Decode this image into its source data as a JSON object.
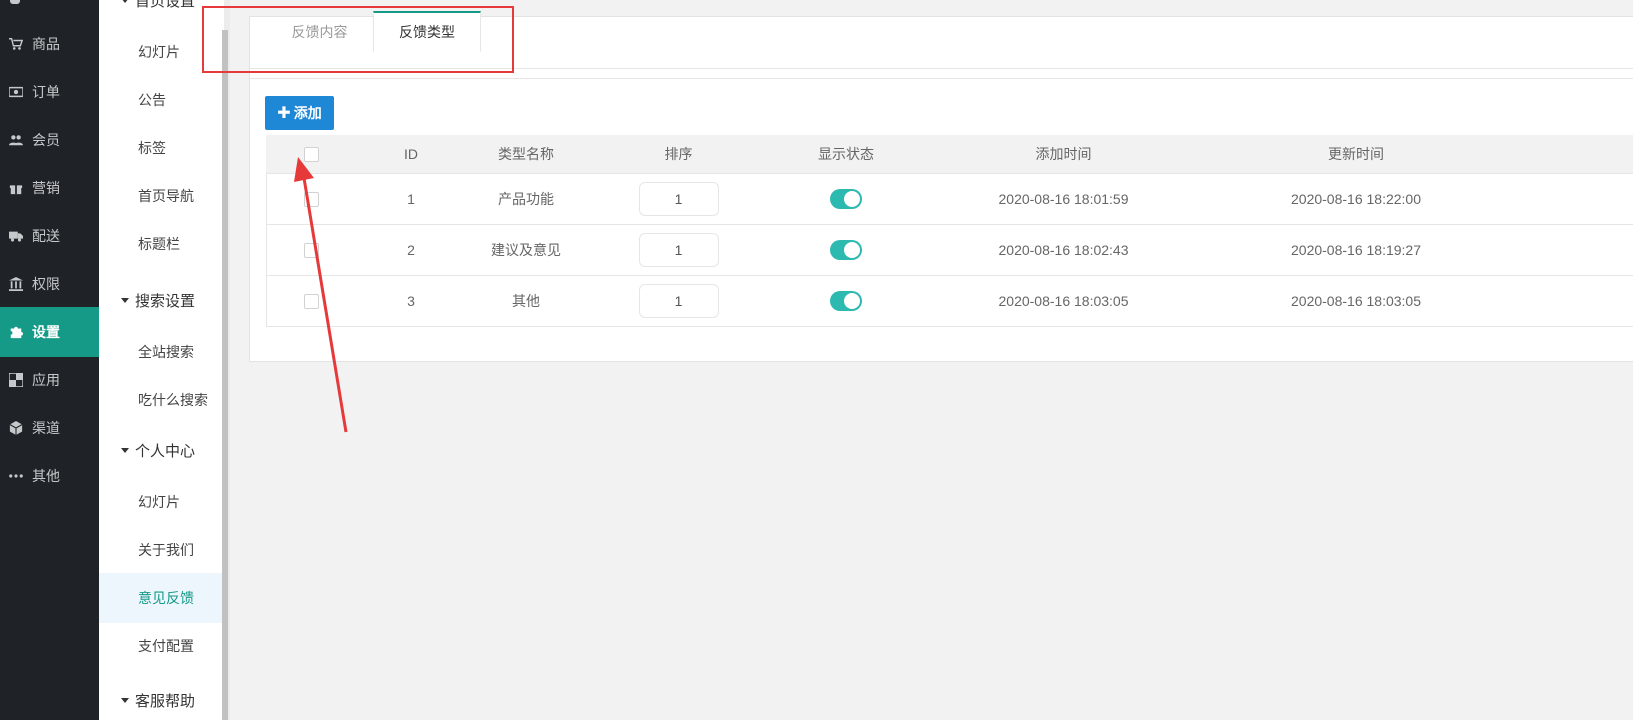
{
  "main_nav": {
    "items": [
      {
        "label": "商品",
        "icon": "cart-icon"
      },
      {
        "label": "订单",
        "icon": "money-icon"
      },
      {
        "label": "会员",
        "icon": "users-icon"
      },
      {
        "label": "营销",
        "icon": "gift-icon"
      },
      {
        "label": "配送",
        "icon": "truck-icon"
      },
      {
        "label": "权限",
        "icon": "bank-icon"
      },
      {
        "label": "设置",
        "icon": "puzzle-icon",
        "active": true
      },
      {
        "label": "应用",
        "icon": "app-icon"
      },
      {
        "label": "渠道",
        "icon": "cube-icon"
      },
      {
        "label": "其他",
        "icon": "dots-icon"
      }
    ]
  },
  "sub_nav": {
    "group_home": "首页设置",
    "home_items": [
      "幻灯片",
      "公告",
      "标签",
      "首页导航",
      "标题栏"
    ],
    "group_search": "搜索设置",
    "search_items": [
      "全站搜索",
      "吃什么搜索"
    ],
    "group_personal": "个人中心",
    "personal_items": [
      "幻灯片",
      "关于我们",
      "意见反馈",
      "支付配置"
    ],
    "group_service": "客服帮助"
  },
  "tabs": {
    "content": "反馈内容",
    "type": "反馈类型"
  },
  "toolbar": {
    "add_label": "添加"
  },
  "table": {
    "headers": {
      "id": "ID",
      "name": "类型名称",
      "sort": "排序",
      "status": "显示状态",
      "created": "添加时间",
      "updated": "更新时间"
    },
    "rows": [
      {
        "id": "1",
        "name": "产品功能",
        "sort": "1",
        "status_on": true,
        "created": "2020-08-16 18:01:59",
        "updated": "2020-08-16 18:22:00"
      },
      {
        "id": "2",
        "name": "建议及意见",
        "sort": "1",
        "status_on": true,
        "created": "2020-08-16 18:02:43",
        "updated": "2020-08-16 18:19:27"
      },
      {
        "id": "3",
        "name": "其他",
        "sort": "1",
        "status_on": true,
        "created": "2020-08-16 18:03:05",
        "updated": "2020-08-16 18:03:05"
      }
    ]
  },
  "colors": {
    "accent": "#149a87",
    "nav_bg": "#1f2226",
    "button_blue": "#1e88d6",
    "switch_on": "#2bb9b0",
    "annotation_red": "#e63a3a"
  }
}
